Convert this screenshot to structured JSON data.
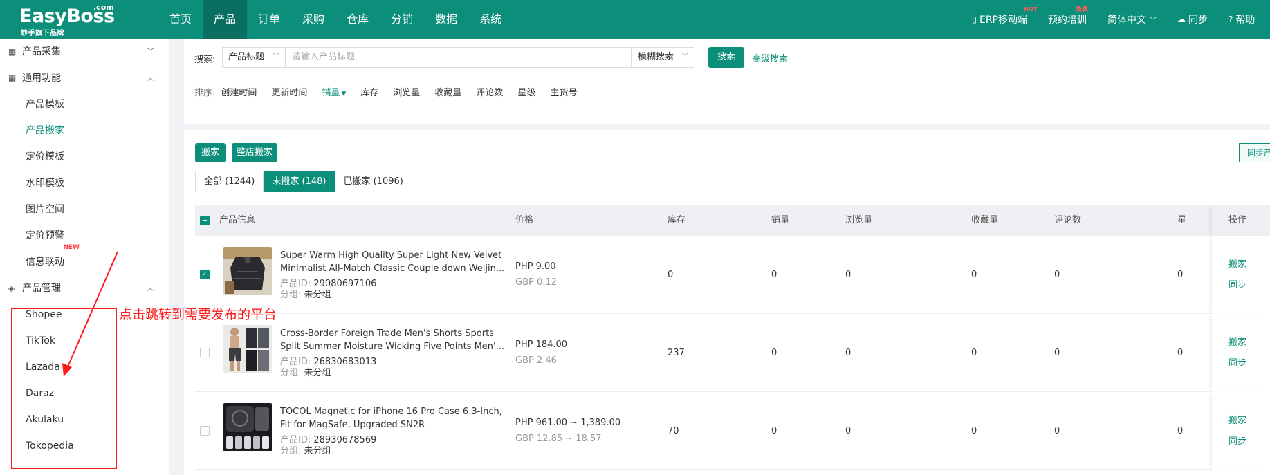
{
  "brand": {
    "name": "EasyBoss",
    "suffix": ".com",
    "tagline": "妙手旗下品牌"
  },
  "nav": {
    "items": [
      "首页",
      "产品",
      "订单",
      "采购",
      "仓库",
      "分销",
      "数据",
      "系统"
    ],
    "active_index": 1
  },
  "topright": {
    "mobile": "ERP移动端",
    "mobile_badge": "HOT",
    "training": "预约培训",
    "training_badge": "免费",
    "language": "简体中文",
    "sync": "同步",
    "help": "帮助"
  },
  "sidebar": {
    "group1": "产品采集",
    "group2": "通用功能",
    "group2_items": [
      "产品模板",
      "产品搬家",
      "定价模板",
      "水印模板",
      "图片空间",
      "定价预警",
      "信息联动"
    ],
    "group2_active_index": 1,
    "new_badge": "NEW",
    "group3": "产品管理",
    "group3_items": [
      "Shopee",
      "TikTok",
      "Lazada",
      "Daraz",
      "Akulaku",
      "Tokopedia"
    ]
  },
  "search": {
    "label": "搜索:",
    "field_select": "产品标题",
    "placeholder": "请输入产品标题",
    "mode_select": "模糊搜索",
    "button": "搜索",
    "advanced": "高级搜索"
  },
  "sort": {
    "label": "排序:",
    "items": [
      "创建时间",
      "更新时间",
      "销量",
      "库存",
      "浏览量",
      "收藏量",
      "评论数",
      "星级",
      "主货号"
    ],
    "active_index": 2
  },
  "actions": {
    "move": "搬家",
    "move_store": "整店搬家",
    "sync_right": "同步产品"
  },
  "tabs": [
    {
      "label": "全部 (1244)"
    },
    {
      "label": "未搬家 (148)"
    },
    {
      "label": "已搬家 (1096)"
    }
  ],
  "tabs_active_index": 1,
  "table": {
    "headers": {
      "product": "产品信息",
      "price": "价格",
      "stock": "库存",
      "sales": "销量",
      "views": "浏览量",
      "favorites": "收藏量",
      "reviews": "评论数",
      "stars": "星",
      "ops": "操作"
    },
    "id_key": "产品ID:",
    "group_key": "分组:",
    "rows": [
      {
        "title1": "Super Warm High Quality Super Light New Velvet",
        "title2": "Minimalist All-Match Classic Couple down Weijin...",
        "id": "29080697106",
        "group": "未分组",
        "price": "PHP 9.00",
        "price2": "GBP 0.12",
        "stock": "0",
        "sales": "0",
        "views": "0",
        "favorites": "0",
        "reviews": "0",
        "stars": "0",
        "op1": "搬家",
        "op2": "同步",
        "checked": true
      },
      {
        "title1": "Cross-Border Foreign Trade Men's Shorts Sports",
        "title2": "Split Summer Moisture Wicking Five Points Men'...",
        "id": "26830683013",
        "group": "未分组",
        "price": "PHP 184.00",
        "price2": "GBP 2.46",
        "stock": "237",
        "sales": "0",
        "views": "0",
        "favorites": "0",
        "reviews": "0",
        "stars": "0",
        "op1": "搬家",
        "op2": "同步",
        "checked": false
      },
      {
        "title1": "TOCOL Magnetic for iPhone 16 Pro Case 6.3-Inch,",
        "title2": "Fit for MagSafe, Upgraded  SN2R",
        "id": "28930678569",
        "group": "未分组",
        "price": "PHP 961.00 ~ 1,389.00",
        "price2": "GBP 12.85 ~ 18.57",
        "stock": "70",
        "sales": "0",
        "views": "0",
        "favorites": "0",
        "reviews": "0",
        "stars": "0",
        "op1": "搬家",
        "op2": "同步",
        "checked": false
      }
    ]
  },
  "annotation": {
    "text": "点击跳转到需要发布的平台",
    "color": "#ff1a1a"
  },
  "colors": {
    "brand": "#0c8f7a",
    "brand_dark": "#0a6f60"
  }
}
